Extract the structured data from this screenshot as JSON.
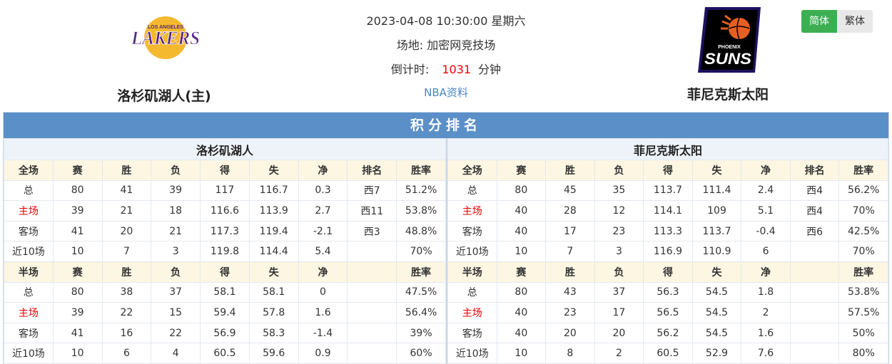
{
  "header": {
    "datetime": "2023-04-08 10:30:00 星期六",
    "venue_label": "场地:",
    "venue": "加密网竞技场",
    "countdown_label": "倒计时:",
    "countdown_value": "1031",
    "countdown_unit": "分钟",
    "link_label": "NBA资料"
  },
  "home_team": {
    "name": "洛杉矶湖人(主)",
    "logo_text_top": "LOS ANGELES",
    "logo_text_main": "LAKERS"
  },
  "away_team": {
    "name": "菲尼克斯太阳",
    "logo_text_top": "PHOENIX",
    "logo_text_main": "SUNS"
  },
  "lang": {
    "simplified": "简体",
    "traditional": "繁体"
  },
  "colors": {
    "accent_blue": "#5b8fc8",
    "header_cell_bg": "#fcf6e3",
    "highlight_red": "#e00000",
    "active_green": "#3caf52"
  },
  "standings": {
    "title": "积分排名",
    "home": {
      "team": "洛杉矶湖人",
      "full_headers": [
        "全场",
        "赛",
        "胜",
        "负",
        "得",
        "失",
        "净",
        "排名",
        "胜率"
      ],
      "full_rows": [
        [
          "总",
          "80",
          "41",
          "39",
          "117",
          "116.7",
          "0.3",
          "西7",
          "51.2%"
        ],
        [
          "主场",
          "39",
          "21",
          "18",
          "116.6",
          "113.9",
          "2.7",
          "西11",
          "53.8%"
        ],
        [
          "客场",
          "41",
          "20",
          "21",
          "117.3",
          "119.4",
          "-2.1",
          "西3",
          "48.8%"
        ],
        [
          "近10场",
          "10",
          "7",
          "3",
          "119.8",
          "114.4",
          "5.4",
          "",
          "70%"
        ]
      ],
      "half_headers": [
        "半场",
        "赛",
        "胜",
        "负",
        "得",
        "失",
        "净",
        "",
        "胜率"
      ],
      "half_rows": [
        [
          "总",
          "80",
          "38",
          "37",
          "58.1",
          "58.1",
          "0",
          "",
          "47.5%"
        ],
        [
          "主场",
          "39",
          "22",
          "15",
          "59.4",
          "57.8",
          "1.6",
          "",
          "56.4%"
        ],
        [
          "客场",
          "41",
          "16",
          "22",
          "56.9",
          "58.3",
          "-1.4",
          "",
          "39%"
        ],
        [
          "近10场",
          "10",
          "6",
          "4",
          "60.5",
          "59.6",
          "0.9",
          "",
          "60%"
        ]
      ]
    },
    "away": {
      "team": "菲尼克斯太阳",
      "full_headers": [
        "全场",
        "赛",
        "胜",
        "负",
        "得",
        "失",
        "净",
        "排名",
        "胜率"
      ],
      "full_rows": [
        [
          "总",
          "80",
          "45",
          "35",
          "113.7",
          "111.4",
          "2.4",
          "西4",
          "56.2%"
        ],
        [
          "主场",
          "40",
          "28",
          "12",
          "114.1",
          "109",
          "5.1",
          "西4",
          "70%"
        ],
        [
          "客场",
          "40",
          "17",
          "23",
          "113.3",
          "113.7",
          "-0.4",
          "西6",
          "42.5%"
        ],
        [
          "近10场",
          "10",
          "7",
          "3",
          "116.9",
          "110.9",
          "6",
          "",
          "70%"
        ]
      ],
      "half_headers": [
        "半场",
        "赛",
        "胜",
        "负",
        "得",
        "失",
        "净",
        "",
        "胜率"
      ],
      "half_rows": [
        [
          "总",
          "80",
          "43",
          "37",
          "56.3",
          "54.5",
          "1.8",
          "",
          "53.8%"
        ],
        [
          "主场",
          "40",
          "23",
          "17",
          "56.5",
          "54.5",
          "2",
          "",
          "57.5%"
        ],
        [
          "客场",
          "40",
          "20",
          "20",
          "56.2",
          "54.5",
          "1.6",
          "",
          "50%"
        ],
        [
          "近10场",
          "10",
          "8",
          "2",
          "60.5",
          "52.9",
          "7.6",
          "",
          "80%"
        ]
      ]
    }
  }
}
